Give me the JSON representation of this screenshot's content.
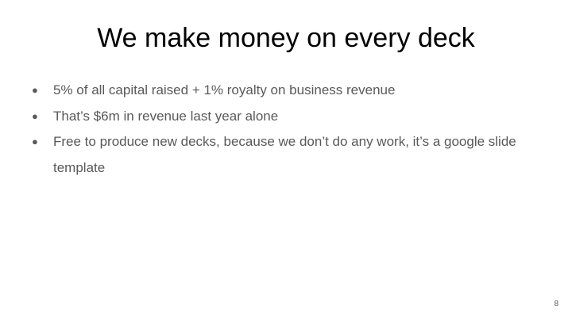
{
  "slide": {
    "title": "We make money on every deck",
    "bullets": [
      "5% of all capital raised + 1% royalty on business revenue",
      "That’s $6m in revenue last year alone",
      "Free to produce new decks, because we don’t do any work, it’s a google slide template"
    ],
    "bullet_glyph": "●",
    "page_number": "8"
  },
  "colors": {
    "background": "#ffffff",
    "title_text": "#000000",
    "body_text": "#595959"
  }
}
